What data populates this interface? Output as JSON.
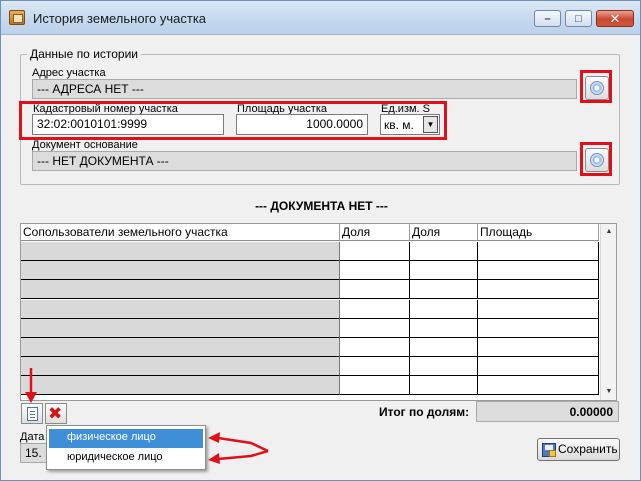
{
  "window": {
    "title": "История земельного участка",
    "min_symbol": "–",
    "max_symbol": "□",
    "close_symbol": "✕"
  },
  "group": {
    "legend": "Данные по истории",
    "address_label": "Адрес участка",
    "address_value": "--- АДРЕСА НЕТ ---",
    "cadastral_label": "Кадастровый номер участка",
    "cadastral_value": "32:02:0010101:9999",
    "area_label": "Площадь участка",
    "area_value": "1000.0000",
    "unit_label": "Ед.изм. S",
    "unit_value": "кв. м.",
    "unit_arrow": "▼",
    "doc_label": "Документ основание",
    "doc_value": "--- НЕТ ДОКУМЕНТА ---"
  },
  "heading": "--- ДОКУМЕНТА НЕТ ---",
  "grid": {
    "columns": [
      "Сопользователи земельного участка",
      "Доля",
      "Доля",
      "Площадь"
    ],
    "rows": 8,
    "scroll_up": "▲",
    "scroll_down": "▼"
  },
  "totals": {
    "label": "Итог по долям:",
    "value": "0.00000"
  },
  "toolbar": {
    "delete_symbol": "✖"
  },
  "popup": {
    "items": [
      "физическое лицо",
      "юридическое лицо"
    ]
  },
  "date_label": "Дата",
  "date_value": "15.",
  "save_label": "Сохранить",
  "colors": {
    "highlight": "#e0101a",
    "selection": "#3f8fd8"
  }
}
